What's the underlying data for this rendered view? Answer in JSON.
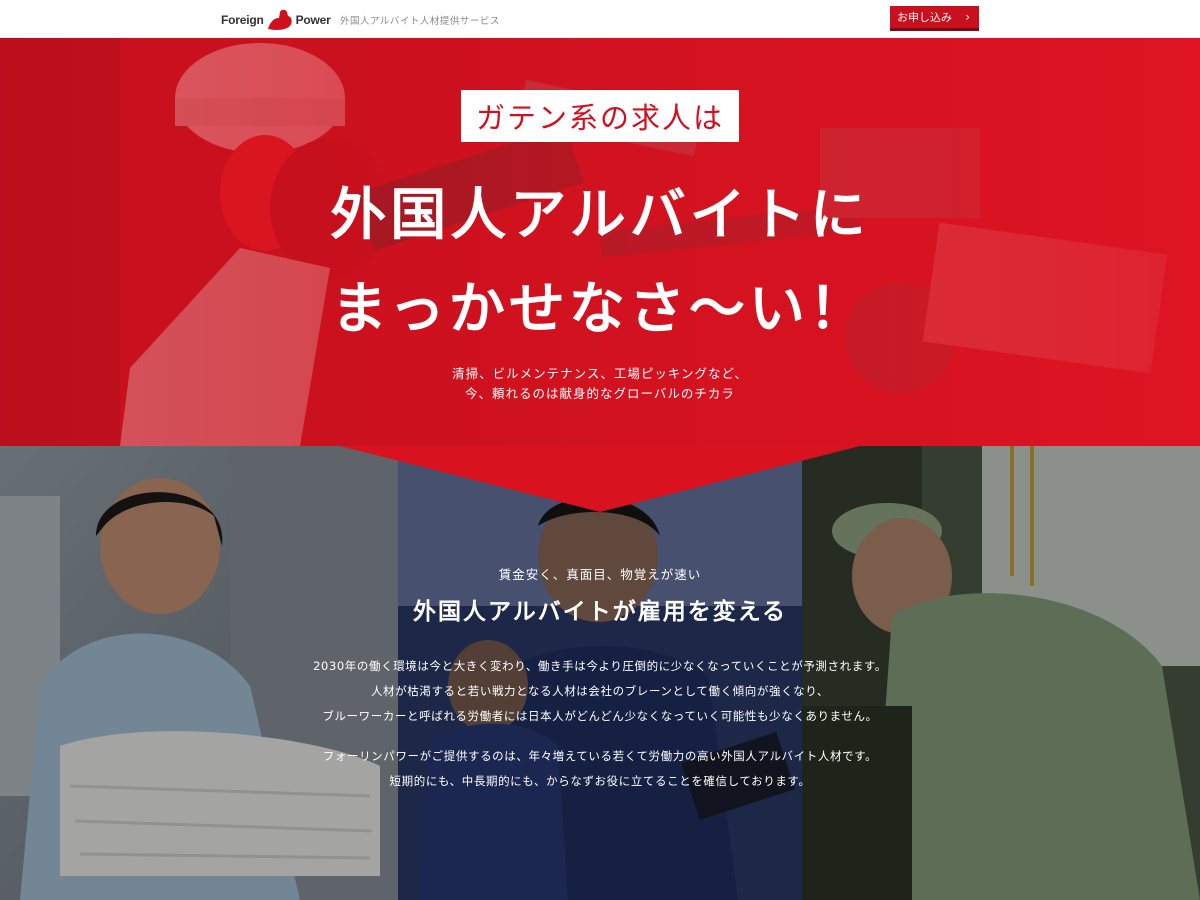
{
  "header": {
    "logo_left": "Foreign",
    "logo_right": "Power",
    "tagline": "外国人アルバイト人材提供サービス",
    "apply_label": "お申し込み",
    "apply_chevron": "›"
  },
  "hero": {
    "badge": "ガテン系の求人は",
    "title_line1": "外国人アルバイトに",
    "title_line2": "まっかせなさ〜い！",
    "sub_line1": "清掃、ビルメンテナンス、工場ピッキングなど、",
    "sub_line2": "今、頼れるのは献身的なグローバルのチカラ"
  },
  "feature": {
    "kicker": "賃金安く、真面目、物覚えが速い",
    "title": "外国人アルバイトが雇用を変える",
    "paragraph1": [
      "2030年の働く環境は今と大きく変わり、働き手は今より圧倒的に少なくなっていくことが予測されます。",
      "人材が枯渇すると若い戦力となる人材は会社のブレーンとして働く傾向が強くなり、",
      "ブルーワーカーと呼ばれる労働者には日本人がどんどん少なくなっていく可能性も少なくありません。"
    ],
    "paragraph2": [
      "フォーリンパワーがご提供するのは、年々増えている若くて労働力の高い外国人アルバイト人材です。",
      "短期的にも、中長期的にも、からなずお役に立てることを確信しております。"
    ]
  },
  "colors": {
    "brand_red": "#d0101e",
    "button_red": "#c8101e",
    "button_shadow": "#7e0810"
  },
  "icons": {
    "logo_mark": "flexed-arm-icon",
    "apply_chevron": "chevron-right-icon"
  }
}
